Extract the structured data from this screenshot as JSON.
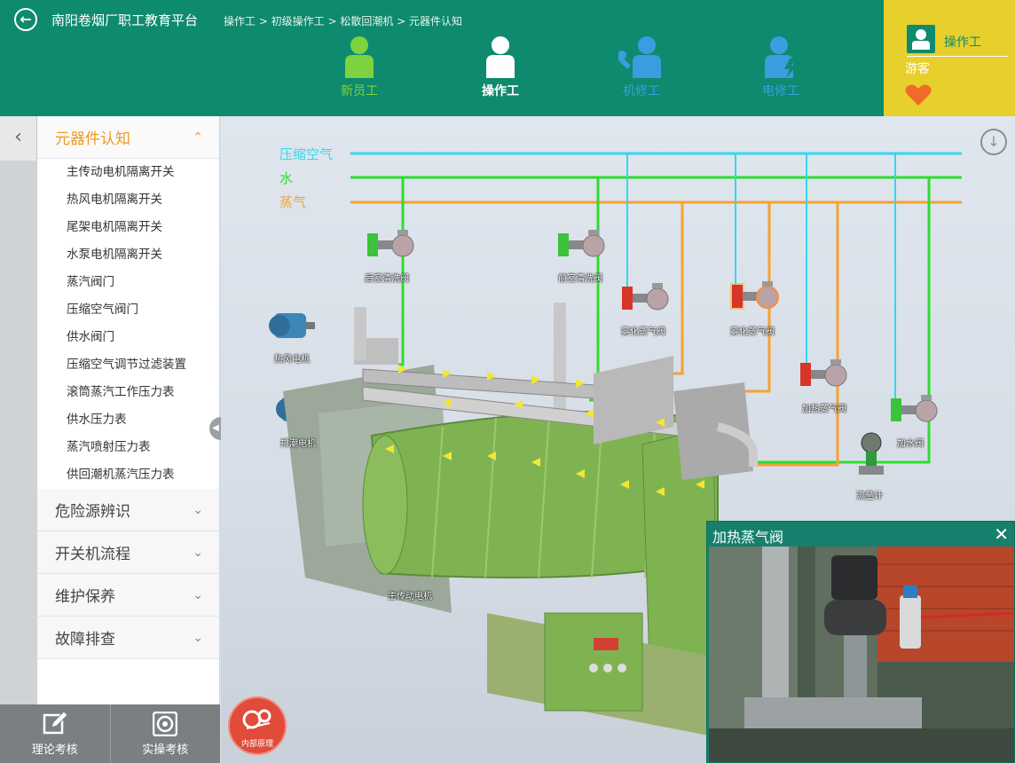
{
  "header": {
    "app_title": "南阳卷烟厂职工教育平台",
    "breadcrumb": "操作工 > 初级操作工 > 松散回潮机 > 元器件认知",
    "roles": [
      {
        "label": "新员工",
        "color": "#7fd23f",
        "selected": false,
        "icon": "person-icon"
      },
      {
        "label": "操作工",
        "color": "#ffffff",
        "selected": true,
        "icon": "person-icon"
      },
      {
        "label": "机修工",
        "color": "#3a9de0",
        "selected": false,
        "icon": "wrench-person-icon"
      },
      {
        "label": "电修工",
        "color": "#3a9de0",
        "selected": false,
        "icon": "lightning-person-icon"
      }
    ],
    "user": {
      "role": "操作工",
      "name": "游客"
    }
  },
  "sidebar": {
    "sections": [
      {
        "label": "元器件认知",
        "expanded": true,
        "items": [
          "主传动电机隔离开关",
          "热风电机隔离开关",
          "尾架电机隔离开关",
          "水泵电机隔离开关",
          "蒸汽阀门",
          "压缩空气阀门",
          "供水阀门",
          "压缩空气调节过滤装置",
          "滚筒蒸汽工作压力表",
          "供水压力表",
          "蒸汽喷射压力表",
          "供回潮机蒸汽压力表"
        ]
      },
      {
        "label": "危险源辨识",
        "expanded": false,
        "items": []
      },
      {
        "label": "开关机流程",
        "expanded": false,
        "items": []
      },
      {
        "label": "维护保养",
        "expanded": false,
        "items": []
      },
      {
        "label": "故障排查",
        "expanded": false,
        "items": []
      }
    ]
  },
  "bottom_tabs": [
    {
      "label": "理论考核",
      "icon": "edit-icon"
    },
    {
      "label": "实操考核",
      "icon": "disc-icon"
    }
  ],
  "diagram": {
    "legend": [
      {
        "label": "压缩空气",
        "color": "#35d7ec"
      },
      {
        "label": "水",
        "color": "#2fdc2f"
      },
      {
        "label": "蒸气",
        "color": "#f4a233"
      }
    ],
    "labels": {
      "rear_clean_valve": "后室清洗阀",
      "front_clean_valve": "前室清洗阀",
      "atomize_steam_valve_1": "雾化蒸气阀",
      "atomize_steam_valve_2": "雾化蒸气阀",
      "heating_steam_valve": "加热蒸气阀",
      "water_valve": "加水阀",
      "flow_meter": "流量计",
      "hot_air_motor": "热风电机",
      "moisture_motor": "排潮电机",
      "main_motor": "主传动电机"
    },
    "flow_button": "内部原理"
  },
  "popup": {
    "title": "加热蒸气阀"
  }
}
